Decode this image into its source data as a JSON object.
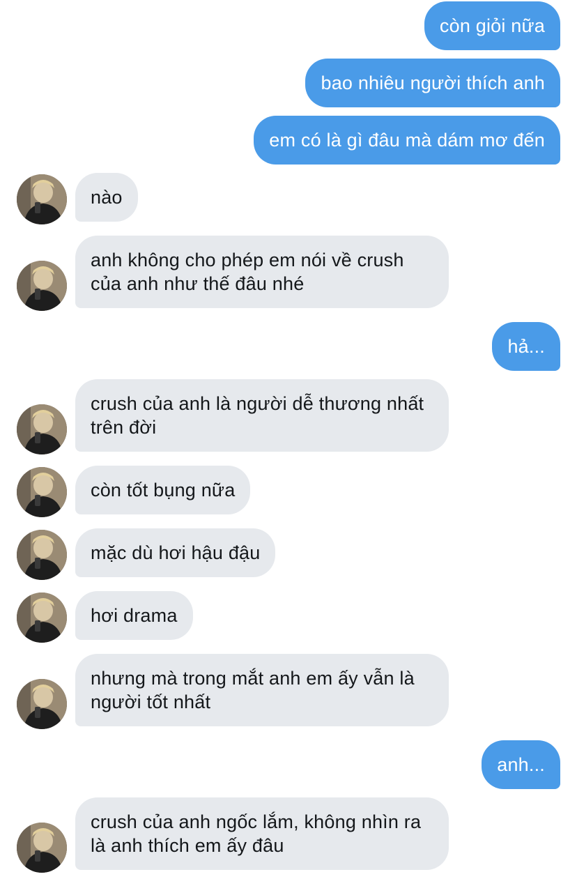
{
  "colors": {
    "sent_bubble": "#4a9be8",
    "received_bubble": "#e6e9ed",
    "received_text": "#14171a",
    "sent_text": "#ffffff"
  },
  "messages": [
    {
      "direction": "sent",
      "text": "còn giỏi nữa"
    },
    {
      "direction": "sent",
      "text": "bao nhiêu người thích anh"
    },
    {
      "direction": "sent",
      "text": "em có là gì đâu mà dám mơ đến"
    },
    {
      "direction": "received",
      "text": "nào"
    },
    {
      "direction": "received",
      "text": "anh không cho phép em nói về crush của anh như thế đâu nhé"
    },
    {
      "direction": "sent",
      "text": "hả..."
    },
    {
      "direction": "received",
      "text": "crush của anh là người dễ thương nhất trên đời"
    },
    {
      "direction": "received",
      "text": "còn tốt bụng nữa"
    },
    {
      "direction": "received",
      "text": "mặc dù hơi hậu đậu"
    },
    {
      "direction": "received",
      "text": "hơi drama"
    },
    {
      "direction": "received",
      "text": "nhưng mà trong mắt anh em ấy vẫn là người tốt nhất"
    },
    {
      "direction": "sent",
      "text": "anh..."
    },
    {
      "direction": "received",
      "text": "crush của anh ngốc lắm, không nhìn ra là anh thích em ấy đâu"
    }
  ]
}
